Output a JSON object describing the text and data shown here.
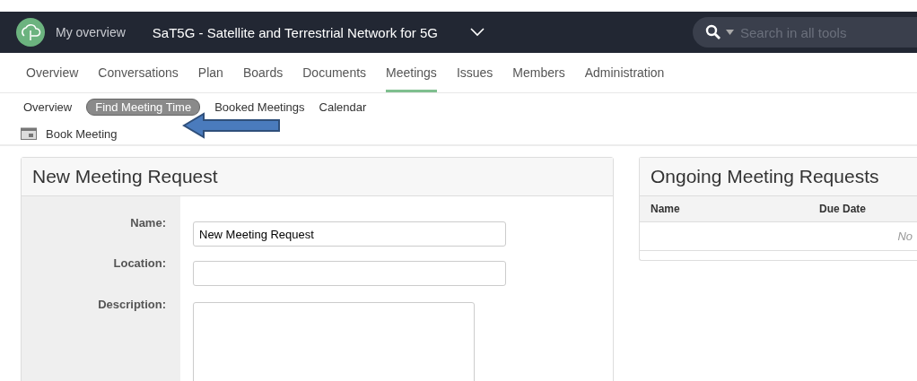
{
  "header": {
    "home_link": "My overview",
    "project_title": "SaT5G - Satellite and Terrestrial Network for 5G",
    "search": {
      "placeholder": "Search in all tools"
    }
  },
  "tabs": [
    {
      "label": "Overview",
      "selected": false
    },
    {
      "label": "Conversations",
      "selected": false
    },
    {
      "label": "Plan",
      "selected": false
    },
    {
      "label": "Boards",
      "selected": false
    },
    {
      "label": "Documents",
      "selected": false
    },
    {
      "label": "Meetings",
      "selected": true
    },
    {
      "label": "Issues",
      "selected": false
    },
    {
      "label": "Members",
      "selected": false
    },
    {
      "label": "Administration",
      "selected": false
    }
  ],
  "subtabs": [
    {
      "label": "Overview",
      "selected": false
    },
    {
      "label": "Find Meeting Time",
      "selected": true
    },
    {
      "label": "Booked Meetings",
      "selected": false
    },
    {
      "label": "Calendar",
      "selected": false
    }
  ],
  "action": {
    "label": "Book Meeting"
  },
  "new_request": {
    "title": "New Meeting Request",
    "fields": [
      {
        "label": "Name:",
        "kind": "input",
        "value": "New Meeting Request"
      },
      {
        "label": "Location:",
        "kind": "input"
      },
      {
        "label": "Description:",
        "kind": "textarea"
      }
    ]
  },
  "ongoing": {
    "title": "Ongoing Meeting Requests",
    "columns": [
      "Name",
      "Due Date"
    ],
    "empty_text": "No"
  }
}
